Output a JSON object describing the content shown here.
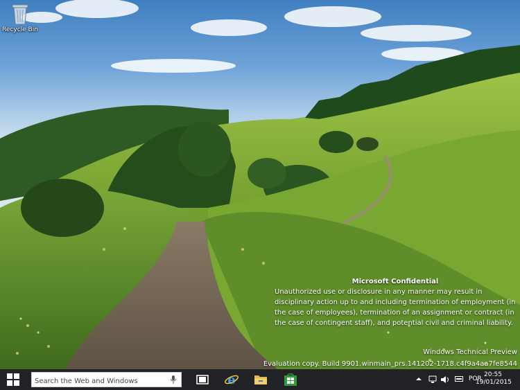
{
  "desktop": {
    "icons": [
      {
        "label": "Recycle Bin",
        "icon": "recycle-bin-icon"
      }
    ]
  },
  "watermark": {
    "title": "Microsoft Confidential",
    "body": "Unauthorized use or disclosure in any manner may result in disciplinary action up to and including termination of employment (in the case of employees), termination of an assignment or contract (in the case of contingent staff), and potential civil and criminal liability.",
    "edition": "Windows Technical Preview",
    "build": "Evaluation copy. Build 9901.winmain_prs.141202-1718.c4f9a4aa7fe8544"
  },
  "taskbar": {
    "start_icon": "windows-logo-icon",
    "search": {
      "placeholder": "Search the Web and Windows",
      "value": "",
      "icon": "microphone-icon"
    },
    "apps": [
      {
        "name": "task-view",
        "icon": "task-view-icon"
      },
      {
        "name": "internet-explorer",
        "icon": "internet-explorer-icon"
      },
      {
        "name": "file-explorer",
        "icon": "folder-icon"
      },
      {
        "name": "store",
        "icon": "store-icon"
      }
    ],
    "tray": {
      "icons": [
        "chevron-up-icon",
        "network-icon",
        "volume-icon",
        "keyboard-icon"
      ],
      "language": "POR",
      "time": "20:55",
      "date": "19/01/2015"
    }
  }
}
